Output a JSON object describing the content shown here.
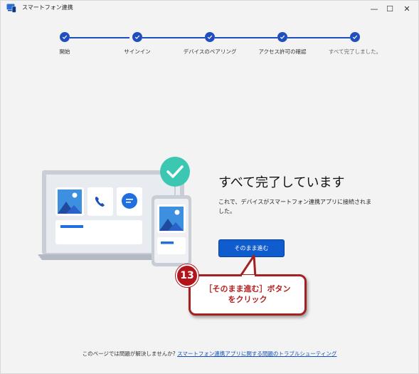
{
  "window": {
    "title": "スマートフォン連携",
    "controls": {
      "minimize": "—",
      "maximize": "☐",
      "close": "✕"
    }
  },
  "stepper": {
    "steps": [
      {
        "label": "開始",
        "state": "done"
      },
      {
        "label": "サインイン",
        "state": "done"
      },
      {
        "label": "デバイスのペアリング",
        "state": "done"
      },
      {
        "label": "アクセス許可の確認",
        "state": "done"
      },
      {
        "label": "すべて完了しました。",
        "state": "done"
      }
    ],
    "accent_color": "#1f4fbf"
  },
  "main": {
    "heading": "すべて完了しています",
    "description": "これで、デバイスがスマートフォン連携アプリに接続されました。",
    "continue_button": "そのまま進む"
  },
  "annotation": {
    "badge_number": "13",
    "line1": "［そのまま進む］ボタン",
    "line2": "をクリック",
    "color": "#b3141a"
  },
  "footer": {
    "prefix": "このページでは問題が解決しませんか?",
    "link": "スマートフォン連携アプリに関する問題のトラブルシューティング"
  },
  "illustration": {
    "icons": [
      "photo-icon",
      "phone-call-icon",
      "message-icon",
      "check-icon"
    ]
  }
}
